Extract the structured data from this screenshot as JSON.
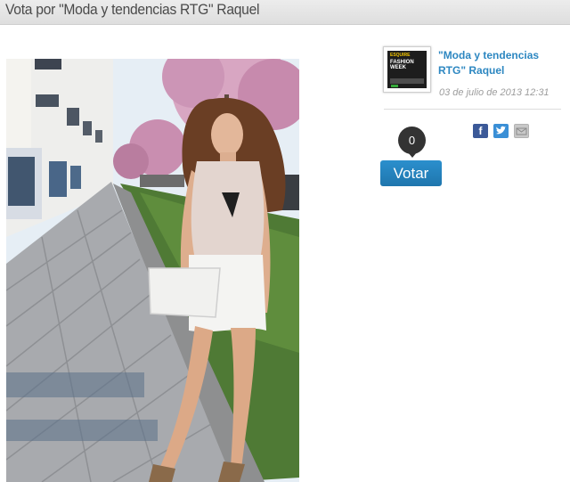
{
  "page": {
    "title": "Vota por \"Moda y tendencias RTG\" Raquel"
  },
  "sidebar": {
    "thumbnail": {
      "brand": "ESQUIRE",
      "event": "FASHION WEEK"
    },
    "post_title": "\"Moda y tendencias RTG\" Raquel",
    "date": "03 de julio de 2013 12:31",
    "vote_count": "0",
    "vote_button": "Votar",
    "share": {
      "facebook_label": "f",
      "icons": [
        "facebook-icon",
        "twitter-icon",
        "email-icon"
      ]
    }
  },
  "colors": {
    "accent": "#2d87c1",
    "button": "#1f7fbe",
    "counter": "#333333",
    "facebook": "#3b5998",
    "twitter": "#3a8fd6"
  }
}
